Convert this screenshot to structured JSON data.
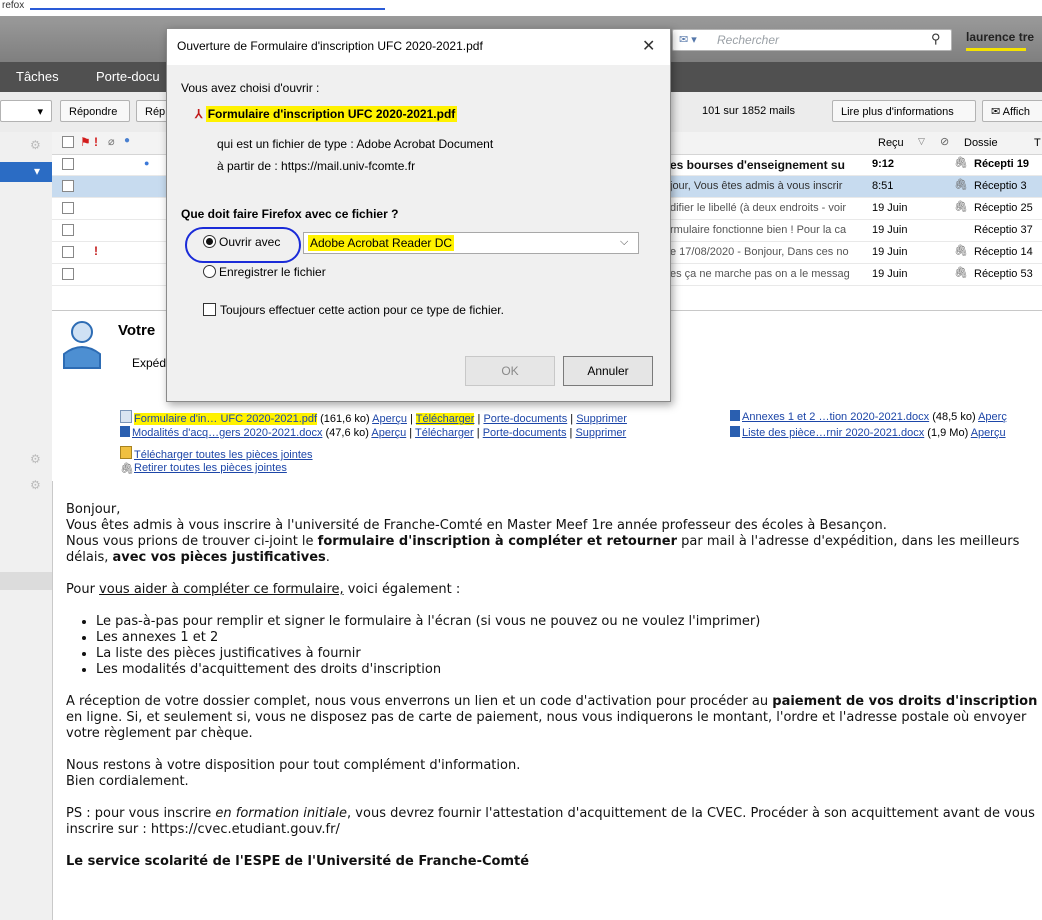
{
  "window": {
    "caption": "refox"
  },
  "search": {
    "placeholder": "Rechercher",
    "user": "laurence tre"
  },
  "menu": {
    "items": [
      "Tâches",
      "Porte-docu"
    ]
  },
  "toolbar": {
    "reply": "Répondre",
    "reply2": "Rép",
    "count": "101 sur 1852 mails",
    "more_info": "Lire plus d'informations",
    "display": "Affich"
  },
  "list": {
    "headers": {
      "received": "Reçu",
      "folder": "Dossie",
      "last": "T"
    },
    "rows": [
      {
        "subject": "es bourses d'enseignement su",
        "time": "9:12",
        "folder": "Récepti",
        "num": "19",
        "bold": true,
        "clip": true
      },
      {
        "subject": "jour, Vous êtes admis à vous inscrir",
        "time": "8:51",
        "folder": "Réceptio",
        "num": "3",
        "bold": false,
        "clip": true
      },
      {
        "subject": "difier le libellé (à deux endroits - voir",
        "time": "19 Juin",
        "folder": "Réceptio",
        "num": "25",
        "bold": false,
        "clip": true
      },
      {
        "subject": "rmulaire fonctionne bien ! Pour la ca",
        "time": "19 Juin",
        "folder": "Réceptio",
        "num": "37",
        "bold": false,
        "clip": false
      },
      {
        "subject": "e 17/08/2020 - Bonjour, Dans ces no",
        "time": "19 Juin",
        "folder": "Réceptio",
        "num": "14",
        "bold": false,
        "clip": true
      },
      {
        "subject": "es ça ne marche pas on a le messag",
        "time": "19 Juin",
        "folder": "Réceptio",
        "num": "53",
        "bold": false,
        "clip": true
      }
    ]
  },
  "preview": {
    "title": "Votre",
    "from": "Expéd"
  },
  "attachments": {
    "a1_name": "Formulaire d'in… UFC 2020-2021.pdf",
    "a1_size": "(161,6 ko)",
    "a2_name": "Annexes 1 et 2 …tion 2020-2021.docx",
    "a2_size": "(48,5 ko)",
    "a2_link": "Aperç",
    "a3_name": "Modalités d'acq…gers 2020-2021.docx",
    "a3_size": "(47,6 ko)",
    "a4_name": "Liste des pièce…rnir 2020-2021.docx",
    "a4_size": "(1,9 Mo)",
    "a4_link": "Aperçu",
    "preview_link": "Aperçu",
    "download_link": "Télécharger",
    "portfolio_link": "Porte-documents",
    "delete_link": "Supprimer",
    "download_all": "Télécharger toutes les pièces jointes",
    "remove_all": "Retirer toutes les pièces jointes"
  },
  "body": {
    "greeting": "Bonjour,",
    "p1_a": "Vous êtes admis à vous inscrire à l'université de Franche-Comté en Master Meef 1re année professeur des écoles à Besançon.",
    "p1_b": "Nous vous prions de trouver ci-joint le ",
    "p1_c": "formulaire d'inscription à compléter et retourner",
    "p1_d": " par mail à l'adresse d'expédition, dans les meilleurs délais, ",
    "p1_e": "avec vos pièces justificatives",
    "p1_f": ".",
    "p2_a": "Pour ",
    "p2_b": "vous aider à compléter ce formulaire,",
    "p2_c": " voici également :",
    "bullets": [
      "Le pas-à-pas pour remplir et signer le formulaire à l'écran (si vous ne pouvez ou ne voulez l'imprimer)",
      "Les annexes 1 et 2",
      "La liste des pièces justificatives à fournir",
      "Les modalités d'acquittement des droits d'inscription"
    ],
    "p3_a": "A réception de votre dossier complet, nous vous enverrons un lien et un code d'activation pour procéder au ",
    "p3_b": "paiement de vos droits d'inscription",
    "p3_c": " en ligne. Si, et seulement si, vous ne disposez pas de carte de paiement, nous vous indiquerons le montant, l'ordre et l'adresse postale où envoyer votre règlement par chèque.",
    "p4_a": "Nous restons à votre disposition pour tout complément d'information.",
    "p4_b": "Bien cordialement.",
    "p5_a": "PS : pour vous inscrire ",
    "p5_b": "en formation initiale",
    "p5_c": ", vous devrez fournir l'attestation d'acquittement de la CVEC. Procéder à son acquittement avant de vous inscrire sur : ",
    "p5_d": "https://cvec.etudiant.gouv.fr/",
    "signature": "Le service scolarité de l'ESPE de l'Université de Franche-Comté"
  },
  "dialog": {
    "title": "Ouverture de Formulaire d'inscription UFC 2020-2021.pdf",
    "chose": "Vous avez choisi d'ouvrir :",
    "filename": "Formulaire d'inscription UFC 2020-2021.pdf",
    "type": "qui est un fichier de type : Adobe Acrobat Document",
    "from": "à partir de : https://mail.univ-fcomte.fr",
    "question": "Que doit faire Firefox avec ce fichier ?",
    "open_with": "Ouvrir avec",
    "app": "Adobe Acrobat Reader DC",
    "save": "Enregistrer le fichier",
    "always": "Toujours effectuer cette action pour ce type de fichier.",
    "ok": "OK",
    "cancel": "Annuler"
  },
  "colors": {
    "highlight": "#fff200",
    "link": "#1d46a8",
    "selection": "#2b6cc4",
    "annotation": "#1a2bd8"
  }
}
